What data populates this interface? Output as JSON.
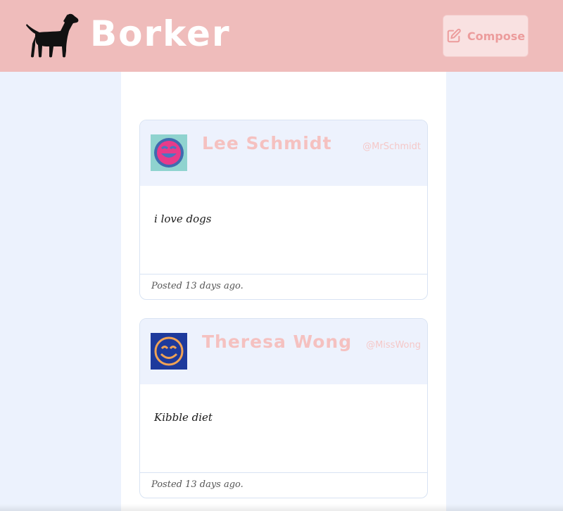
{
  "header": {
    "brand": "Borker",
    "logo_icon": "dog-icon",
    "compose_label": "Compose",
    "compose_icon": "edit-icon",
    "colors": {
      "header_bg": "#efbcbb",
      "accent": "#ec9c9c"
    }
  },
  "posts": [
    {
      "author": "Lee Schmidt",
      "handle": "@MrSchmidt",
      "text": "i love dogs",
      "posted": "Posted 13 days ago.",
      "avatar_icon": "laughing-face-icon"
    },
    {
      "author": "Theresa Wong",
      "handle": "@MissWong",
      "text": "Kibble diet",
      "posted": "Posted 13 days ago.",
      "avatar_icon": "smiling-face-icon"
    }
  ]
}
